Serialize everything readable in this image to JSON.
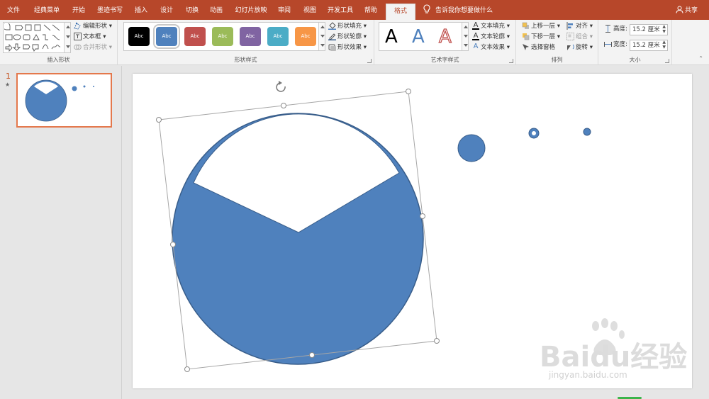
{
  "menu": {
    "tabs": [
      {
        "label": "文件",
        "active": false
      },
      {
        "label": "经典菜单",
        "active": false
      },
      {
        "label": "开始",
        "active": false
      },
      {
        "label": "墨迹书写",
        "active": false
      },
      {
        "label": "插入",
        "active": false
      },
      {
        "label": "设计",
        "active": false
      },
      {
        "label": "切换",
        "active": false
      },
      {
        "label": "动画",
        "active": false
      },
      {
        "label": "幻灯片放映",
        "active": false
      },
      {
        "label": "审阅",
        "active": false
      },
      {
        "label": "视图",
        "active": false
      },
      {
        "label": "开发工具",
        "active": false
      },
      {
        "label": "帮助",
        "active": false
      },
      {
        "label": "格式",
        "active": true
      }
    ],
    "tell_me": "告诉我你想要做什么",
    "share": "共享"
  },
  "ribbon": {
    "insert_shapes": {
      "label": "插入形状",
      "edit_shape": "编辑形状",
      "text_box": "文本框",
      "merge_shapes": "合并形状"
    },
    "shape_styles": {
      "label": "形状样式",
      "preset_text": "Abc",
      "presets": [
        {
          "name": "black",
          "color": "#000000"
        },
        {
          "name": "blue",
          "color": "#4f81bd"
        },
        {
          "name": "red",
          "color": "#c0504d"
        },
        {
          "name": "green",
          "color": "#9bbb59"
        },
        {
          "name": "purple",
          "color": "#8064a2"
        },
        {
          "name": "aqua",
          "color": "#4bacc6"
        },
        {
          "name": "orange",
          "color": "#f79646"
        }
      ],
      "fill": "形状填充",
      "outline": "形状轮廓",
      "effects": "形状效果"
    },
    "wordart": {
      "label": "艺术字样式",
      "letter": "A",
      "text_fill": "文本填充",
      "text_outline": "文本轮廓",
      "text_effects": "文本效果"
    },
    "arrange": {
      "label": "排列",
      "bring_forward": "上移一层",
      "send_backward": "下移一层",
      "selection_pane": "选择窗格",
      "align": "对齐",
      "group": "组合",
      "rotate": "旋转"
    },
    "size": {
      "label": "大小",
      "height_label": "高度:",
      "height_value": "15.2 厘米",
      "width_label": "宽度:",
      "width_value": "15.2 厘米"
    }
  },
  "thumbnails": {
    "number": "1",
    "star": "★"
  },
  "watermark": {
    "brand": "Baidu经验",
    "url": "jingyan.baidu.com"
  },
  "colors": {
    "accent": "#b7472a",
    "shape_fill": "#4f81bd",
    "shape_stroke": "#385d8a"
  }
}
